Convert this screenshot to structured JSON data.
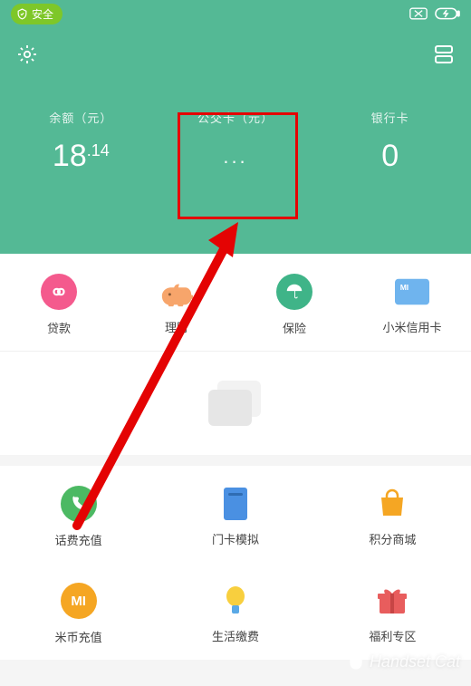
{
  "status": {
    "security_label": "安全"
  },
  "balances": {
    "balance": {
      "label": "余额（元）",
      "int": "18",
      "cents": ".14"
    },
    "transit": {
      "label": "公交卡（元）",
      "display": "..."
    },
    "bank": {
      "label": "银行卡",
      "value": "0"
    }
  },
  "quick_row": {
    "loan": "贷款",
    "finance": "理财",
    "insurance": "保险",
    "credit": "小米信用卡"
  },
  "grid": {
    "topup": "话费充值",
    "door": "门卡模拟",
    "points": "积分商城",
    "mi_coin": "米币充值",
    "bills": "生活缴费",
    "welfare": "福利专区"
  },
  "watermark": "Handset Cat"
}
